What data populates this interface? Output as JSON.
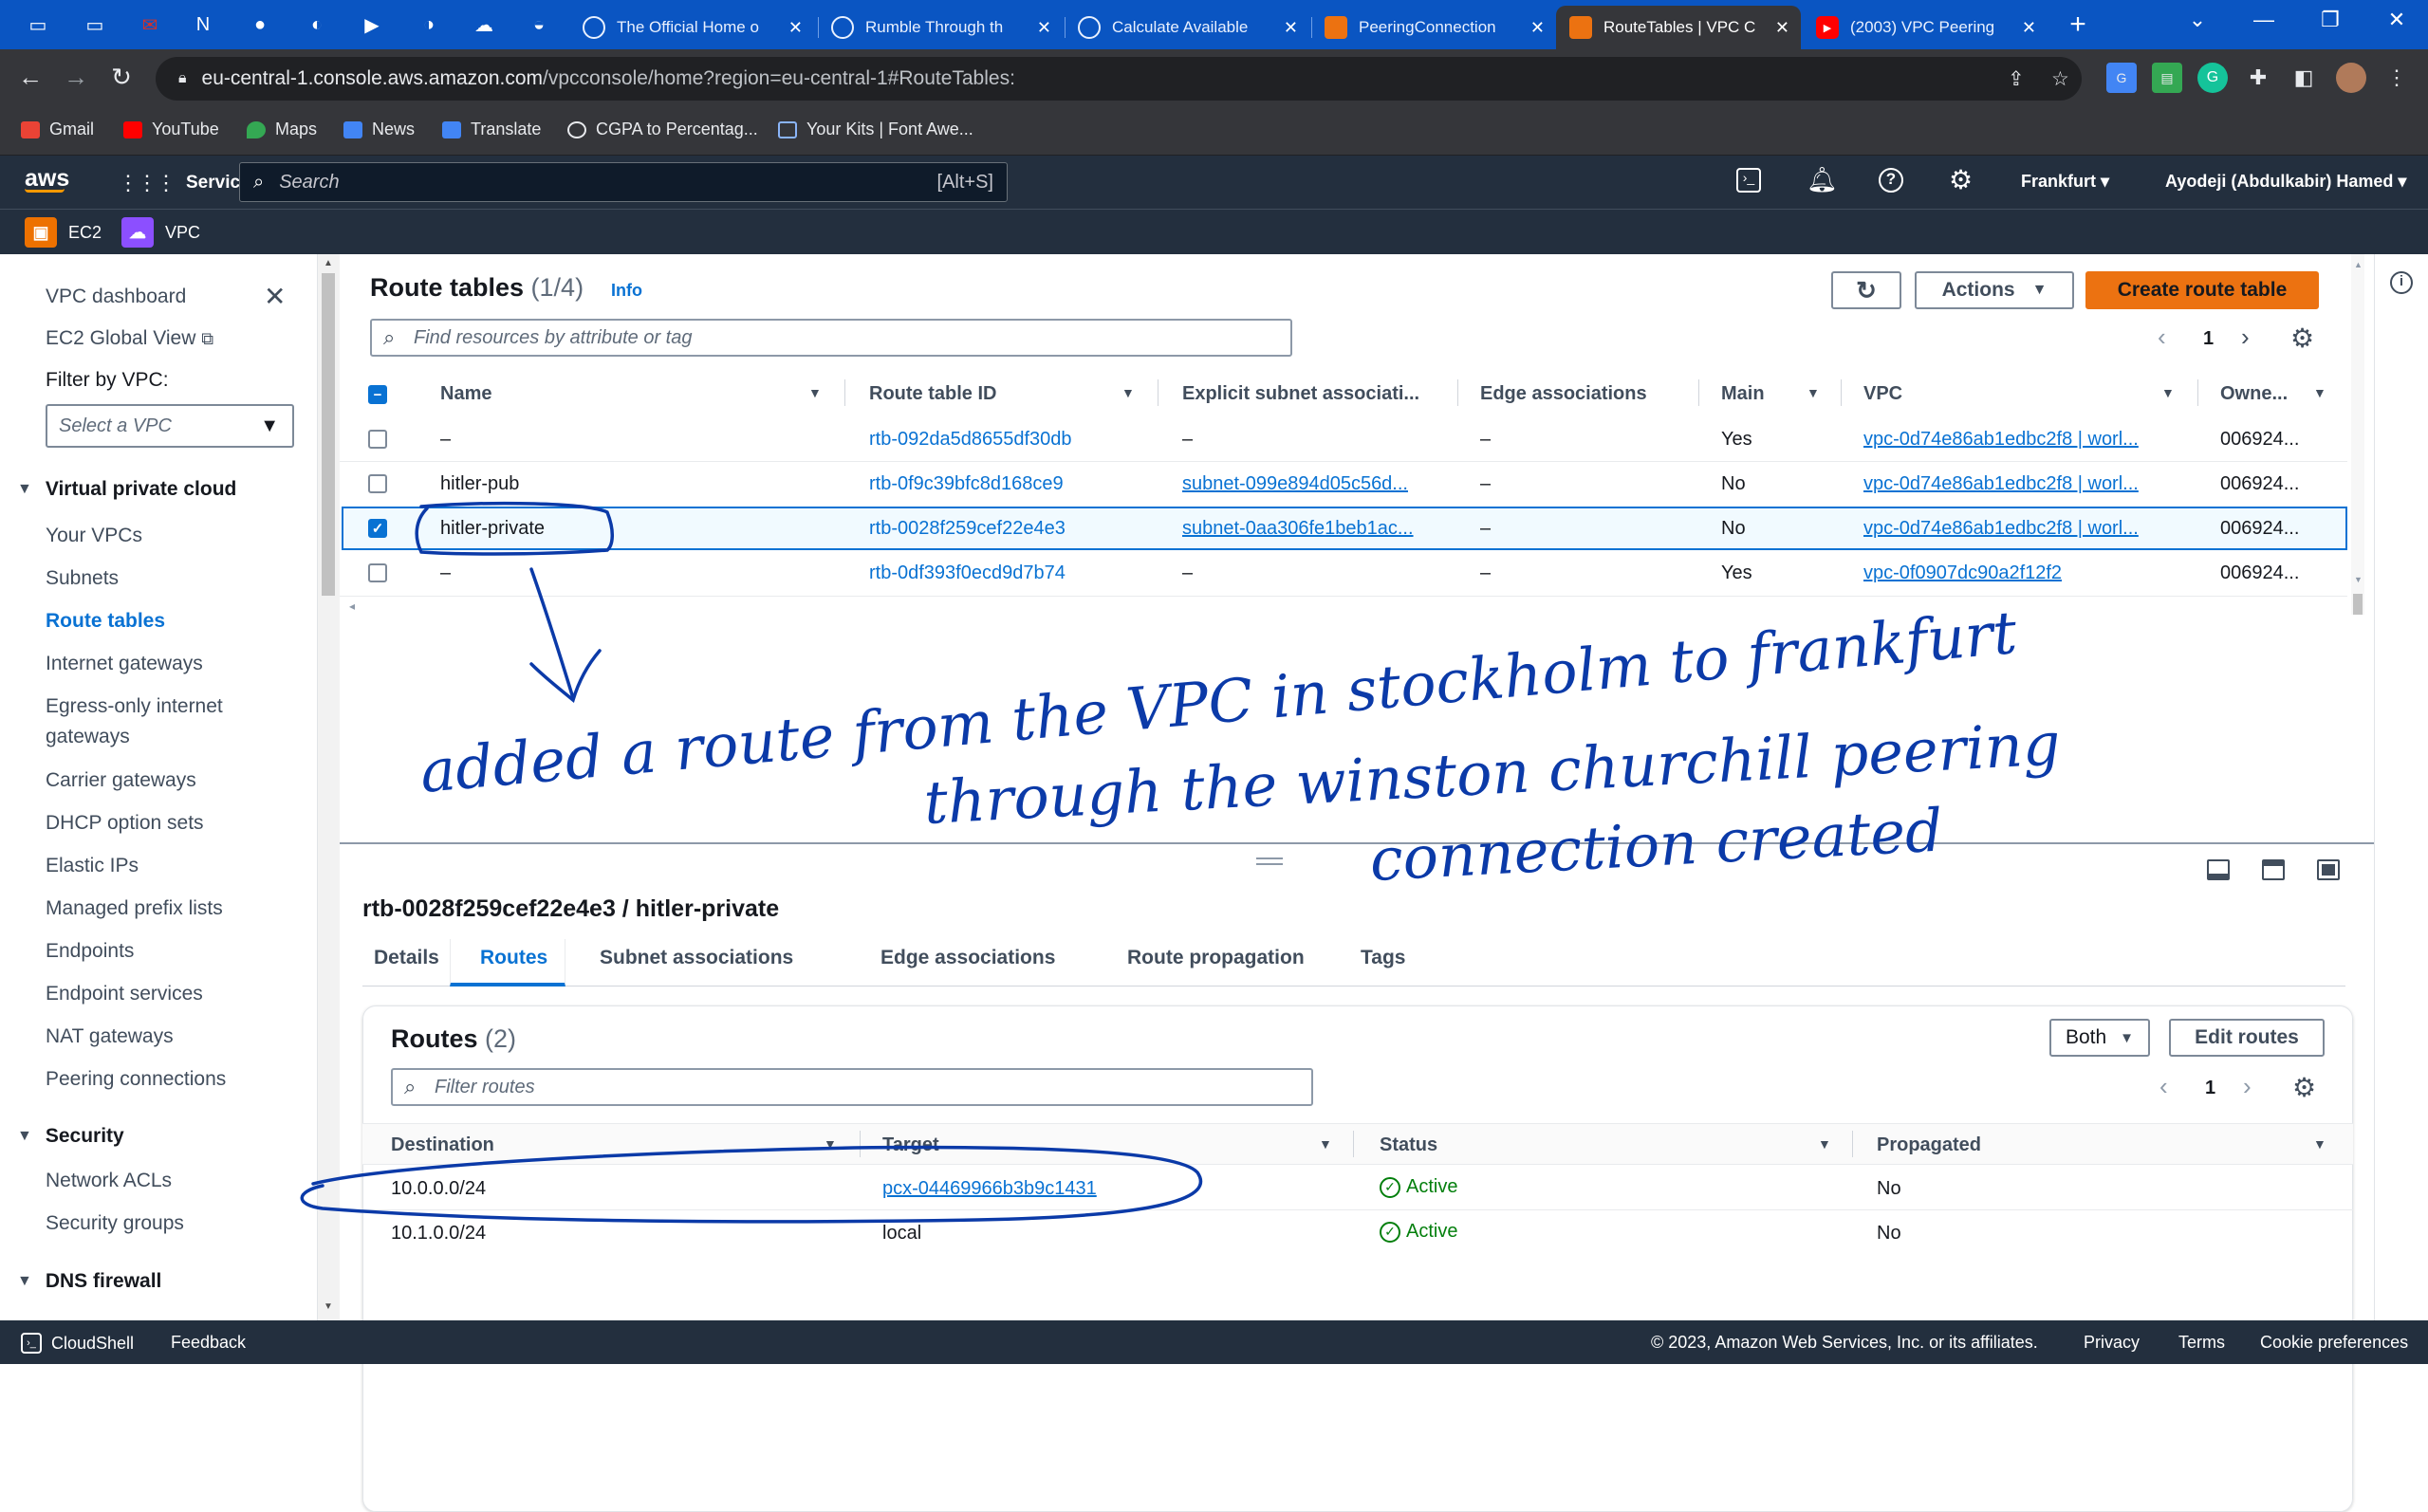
{
  "browser": {
    "tabs": [
      {
        "title": "The Official Home o"
      },
      {
        "title": "Rumble Through th"
      },
      {
        "title": "Calculate Available"
      },
      {
        "title": "PeeringConnection"
      },
      {
        "title": "RouteTables | VPC C"
      },
      {
        "title": "(2003) VPC Peering"
      }
    ],
    "url_host": "eu-central-1.console.aws.amazon.com",
    "url_path": "/vpcconsole/home?region=eu-central-1#RouteTables:",
    "bookmarks": [
      "Gmail",
      "YouTube",
      "Maps",
      "News",
      "Translate",
      "CGPA to Percentag...",
      "Your Kits | Font Awe..."
    ]
  },
  "aws_header": {
    "logo": "aws",
    "services": "Services",
    "search_placeholder": "Search",
    "search_shortcut": "[Alt+S]",
    "region": "Frankfurt",
    "user": "Ayodeji (Abdulkabir) Hamed",
    "favorites": [
      "EC2",
      "VPC"
    ]
  },
  "sidebar": {
    "dashboard": "VPC dashboard",
    "global_view": "EC2 Global View",
    "filter_label": "Filter by VPC:",
    "filter_placeholder": "Select a VPC",
    "section_vpc": "Virtual private cloud",
    "items": [
      "Your VPCs",
      "Subnets",
      "Route tables",
      "Internet gateways",
      "Egress-only internet",
      "gateways",
      "Carrier gateways",
      "DHCP option sets",
      "Elastic IPs",
      "Managed prefix lists",
      "Endpoints",
      "Endpoint services",
      "NAT gateways",
      "Peering connections"
    ],
    "section_security": "Security",
    "security_items": [
      "Network ACLs",
      "Security groups"
    ],
    "section_dns": "DNS firewall"
  },
  "route_tables": {
    "title": "Route tables",
    "count": "(1/4)",
    "info": "Info",
    "actions": "Actions",
    "create": "Create route table",
    "search_placeholder": "Find resources by attribute or tag",
    "page": "1",
    "columns": [
      "Name",
      "Route table ID",
      "Explicit subnet associati...",
      "Edge associations",
      "Main",
      "VPC",
      "Owne..."
    ],
    "rows": [
      {
        "name": "–",
        "id": "rtb-092da5d8655df30db",
        "subnet": "–",
        "edge": "–",
        "main": "Yes",
        "vpc": "vpc-0d74e86ab1edbc2f8 | worl...",
        "owner": "006924..."
      },
      {
        "name": "hitler-pub",
        "id": "rtb-0f9c39bfc8d168ce9",
        "subnet": "subnet-099e894d05c56d...",
        "edge": "–",
        "main": "No",
        "vpc": "vpc-0d74e86ab1edbc2f8 | worl...",
        "owner": "006924..."
      },
      {
        "name": "hitler-private",
        "id": "rtb-0028f259cef22e4e3",
        "subnet": "subnet-0aa306fe1beb1ac...",
        "edge": "–",
        "main": "No",
        "vpc": "vpc-0d74e86ab1edbc2f8 | worl...",
        "owner": "006924..."
      },
      {
        "name": "–",
        "id": "rtb-0df393f0ecd9d7b74",
        "subnet": "–",
        "edge": "–",
        "main": "Yes",
        "vpc": "vpc-0f0907dc90a2f12f2",
        "owner": "006924..."
      }
    ]
  },
  "annotation": {
    "line1": "added a route from the VPC in stockholm to frankfurt",
    "line2": "through the winston churchill peering",
    "line3": "connection created"
  },
  "detail": {
    "title": "rtb-0028f259cef22e4e3 / hitler-private",
    "tabs": [
      "Details",
      "Routes",
      "Subnet associations",
      "Edge associations",
      "Route propagation",
      "Tags"
    ],
    "routes_title": "Routes",
    "routes_count": "(2)",
    "both": "Both",
    "edit": "Edit routes",
    "filter_placeholder": "Filter routes",
    "page": "1",
    "columns": [
      "Destination",
      "Target",
      "Status",
      "Propagated"
    ],
    "rows": [
      {
        "destination": "10.0.0.0/24",
        "target": "pcx-04469966b3b9c1431",
        "status": "Active",
        "propagated": "No"
      },
      {
        "destination": "10.1.0.0/24",
        "target": "local",
        "status": "Active",
        "propagated": "No"
      }
    ]
  },
  "footer": {
    "cloudshell": "CloudShell",
    "feedback": "Feedback",
    "copyright": "© 2023, Amazon Web Services, Inc. or its affiliates.",
    "privacy": "Privacy",
    "terms": "Terms",
    "cookies": "Cookie preferences"
  },
  "colors": {
    "aws_nav": "#232f3e",
    "primary_button": "#ec7211",
    "link": "#0972d3",
    "active_status": "#037f0c",
    "ink": "#0b3aa8"
  }
}
